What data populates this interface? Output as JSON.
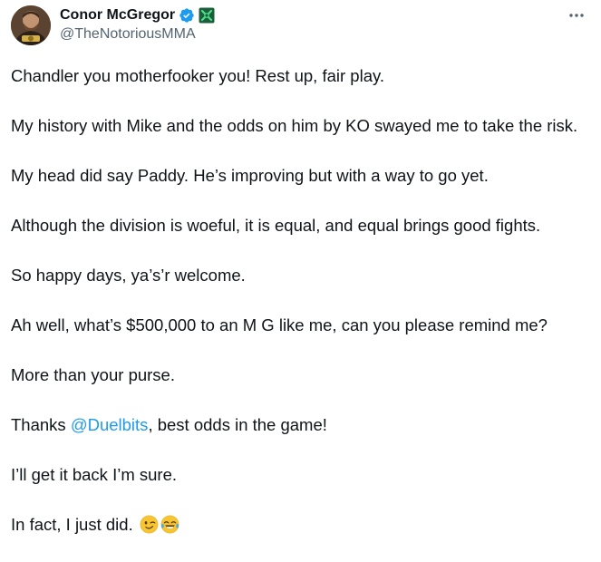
{
  "author": {
    "display_name": "Conor McGregor",
    "handle": "@TheNotoriousMMA",
    "avatar_icon": "profile-photo",
    "verified_icon": "verified-badge-icon",
    "affiliate_icon": "affiliate-badge-icon",
    "verified_color": "#1d9bf0",
    "affiliate_color": "#1b5e3a"
  },
  "menu": {
    "more_icon": "more-horizontal-icon",
    "label": "···"
  },
  "tweet": {
    "paragraphs": [
      "Chandler you motherfooker you! Rest up, fair play.",
      "My history with Mike and the odds on him by KO swayed me to take the risk.",
      "My head did say Paddy. He’s improving but with a way to go yet.",
      "Although the division is woeful, it is equal, and equal brings good fights.",
      "So happy days, ya’s’r welcome.",
      "Ah well, what’s $500,000 to an M G like me, can you please remind me?",
      "More than your purse."
    ],
    "thanks": {
      "prefix": "Thanks ",
      "mention": "@Duelbits",
      "suffix": ", best odds in the game!"
    },
    "p_get_back": "I’ll get it back I’m sure.",
    "final": {
      "text": "In fact, I just did. ",
      "emojis": [
        "winking-face-emoji",
        "face-with-tears-of-joy-emoji"
      ]
    }
  },
  "colors": {
    "text": "#0f1419",
    "secondary": "#536471",
    "link": "#1d9bf0"
  }
}
